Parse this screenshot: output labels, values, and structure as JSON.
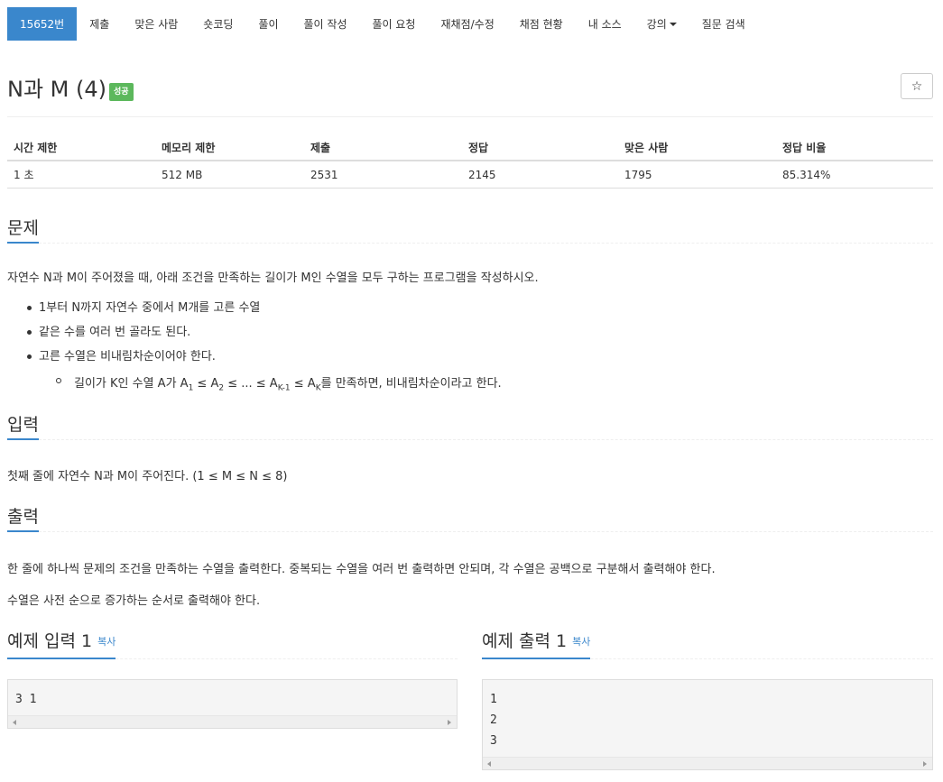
{
  "nav": {
    "items": [
      "15652번",
      "제출",
      "맞은 사람",
      "숏코딩",
      "풀이",
      "풀이 작성",
      "풀이 요청",
      "재채점/수정",
      "채점 현황",
      "내 소스",
      "강의",
      "질문 검색"
    ]
  },
  "problem": {
    "title": "N과 M (4)",
    "badge": "성공",
    "star_icon": "☆"
  },
  "info": {
    "headers": [
      "시간 제한",
      "메모리 제한",
      "제출",
      "정답",
      "맞은 사람",
      "정답 비율"
    ],
    "values": [
      "1 초",
      "512 MB",
      "2531",
      "2145",
      "1795",
      "85.314%"
    ]
  },
  "sections": {
    "problem_title": "문제",
    "problem_text": "자연수 N과 M이 주어졌을 때, 아래 조건을 만족하는 길이가 M인 수열을 모두 구하는 프로그램을 작성하시오.",
    "bullets": [
      "1부터 N까지 자연수 중에서 M개를 고른 수열",
      "같은 수를 여러 번 골라도 된다.",
      "고른 수열은 비내림차순이어야 한다."
    ],
    "sub_bullet": {
      "prefix": "길이가 K인 수열 A가 A",
      "sub1": "1",
      "le1": " ≤ A",
      "sub2": "2",
      "le2": " ≤ ... ≤ A",
      "sub3": "K-1",
      "le3": " ≤ A",
      "sub4": "K",
      "suffix": "를 만족하면, 비내림차순이라고 한다."
    },
    "input_title": "입력",
    "input_text": "첫째 줄에 자연수 N과 M이 주어진다. (1 ≤ M ≤ N ≤ 8)",
    "output_title": "출력",
    "output_text1": "한 줄에 하나씩 문제의 조건을 만족하는 수열을 출력한다. 중복되는 수열을 여러 번 출력하면 안되며, 각 수열은 공백으로 구분해서 출력해야 한다.",
    "output_text2": "수열은 사전 순으로 증가하는 순서로 출력해야 한다."
  },
  "examples": {
    "input_title": "예제 입력 1",
    "output_title": "예제 출력 1",
    "copy_label": "복사",
    "input_lines": [
      "3 1"
    ],
    "output_lines": [
      "1",
      "2",
      "3"
    ]
  }
}
